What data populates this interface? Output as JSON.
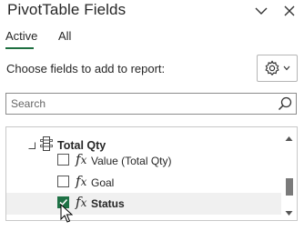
{
  "header": {
    "title": "PivotTable Fields",
    "options_icon": "chevron-down-icon",
    "close_icon": "close-icon"
  },
  "tabs": [
    {
      "label": "Active",
      "selected": true
    },
    {
      "label": "All",
      "selected": false
    }
  ],
  "choose_fields_label": "Choose fields to add to report:",
  "settings_button": {
    "icon": "gear-icon",
    "dropdown_icon": "chevron-down-icon"
  },
  "search": {
    "placeholder": "Search",
    "value": "",
    "icon": "search-icon"
  },
  "field_list": {
    "group": {
      "label": "Total Qty",
      "expanded": true,
      "icon": "table-icon"
    },
    "fields": [
      {
        "label": "Value (Total Qty)",
        "checked": false,
        "icon": "fx-icon",
        "fx": "fx"
      },
      {
        "label": "Goal",
        "checked": false,
        "icon": "fx-icon",
        "fx": "fx"
      },
      {
        "label": "Status",
        "checked": true,
        "icon": "fx-icon",
        "fx": "fx"
      }
    ]
  },
  "colors": {
    "accent": "#1e6f40",
    "checkbox_checked": "#1e7145",
    "hover_row": "#f0f0f0",
    "text": "#262626"
  }
}
